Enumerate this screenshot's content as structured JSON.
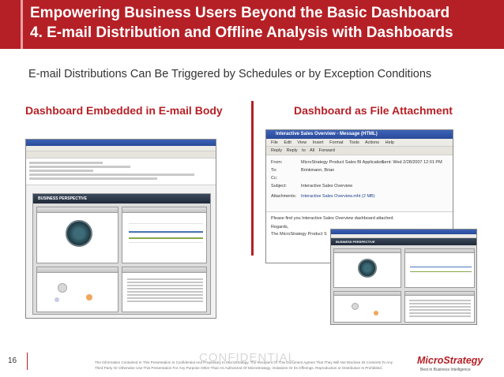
{
  "header": {
    "title_line1": "Empowering Business Users Beyond the Basic Dashboard",
    "title_line2": "4.  E-mail Distribution and Offline Analysis with Dashboards"
  },
  "subtitle": "E-mail Distributions Can Be Triggered by Schedules or by Exception Conditions",
  "columns": {
    "left_heading": "Dashboard Embedded in E-mail Body",
    "right_heading": "Dashboard as File Attachment"
  },
  "left_shot": {
    "dashboard_brand": "BUSINESS PERSPECTIVE",
    "panels": [
      "Corporate Performance",
      "Regional Performance",
      "Category Analysis",
      "Subcategory Analysis"
    ]
  },
  "right_shot": {
    "window_title": "Interactive Sales Overview - Message (HTML)",
    "menu": [
      "File",
      "Edit",
      "View",
      "Insert",
      "Format",
      "Tools",
      "Actions",
      "Help"
    ],
    "toolbar": [
      "Reply",
      "Reply to All",
      "Forward"
    ],
    "from_label": "From:",
    "from_value": "MicroStrategy Product Sales BI Application",
    "sent_label": "Sent:",
    "sent_value": "Wed 2/28/2007 12:01 PM",
    "to_label": "To:",
    "to_value": "Brinkmann, Brian",
    "cc_label": "Cc:",
    "subject_label": "Subject:",
    "subject_value": "Interactive Sales Overview",
    "attachments_label": "Attachments:",
    "attachment_value": "Interactive Sales Overview.mht (2 MB)",
    "body_line1": "Please find you Interactive Sales Overview dashboard attached.",
    "body_line2": "Regards,",
    "body_line3": "The MicroStrategy Product S",
    "dashboard_brand": "BUSINESS PERSPECTIVE",
    "panels": [
      "Corporate Performance",
      "Regional Performance",
      "Category Analysis",
      "Subcategory Analysis"
    ]
  },
  "footer": {
    "page_number": "16",
    "confidential": "CONFIDENTIAL",
    "disclaimer": "The Information Contained In This Presentation Is Confidential And Proprietary to MicroStrategy. The Recipient Of This Document Agrees That They Will Not Disclose Its Contents To Any Third Party Or Otherwise Use This Presentation For Any Purpose Other Than As Authorized Of MicroStrategy. Violations Or Its Offerings. Reproduction or Distribution Is Prohibited.",
    "logo": "MicroStrategy",
    "tagline": "Best in Business Intelligence"
  },
  "colors": {
    "brand_red": "#b52026",
    "window_blue": "#2a4a99",
    "dashboard_dark": "#1f2a38"
  }
}
